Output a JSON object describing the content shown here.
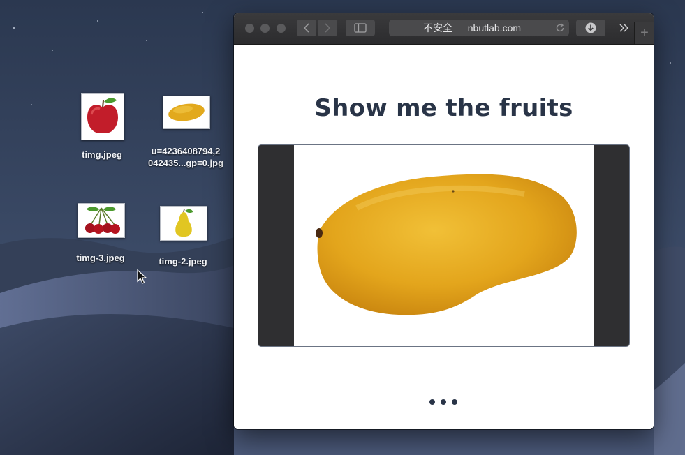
{
  "desktop": {
    "files": [
      {
        "name": "timg.jpeg",
        "fruit": "apple"
      },
      {
        "name": "u=4236408794,2",
        "name_line2": "042435...gp=0.jpg",
        "fruit": "mango"
      },
      {
        "name": "timg-3.jpeg",
        "fruit": "cherries"
      },
      {
        "name": "timg-2.jpeg",
        "fruit": "pear"
      }
    ]
  },
  "browser": {
    "address": "不安全 — nbutlab.com",
    "new_tab_glyph": "+",
    "page": {
      "heading": "Show me the fruits",
      "displayed_image": "mango"
    }
  },
  "colors": {
    "heading": "#293447",
    "toolbar": "#2c2c2e",
    "viewer_background": "#2f2f31"
  }
}
